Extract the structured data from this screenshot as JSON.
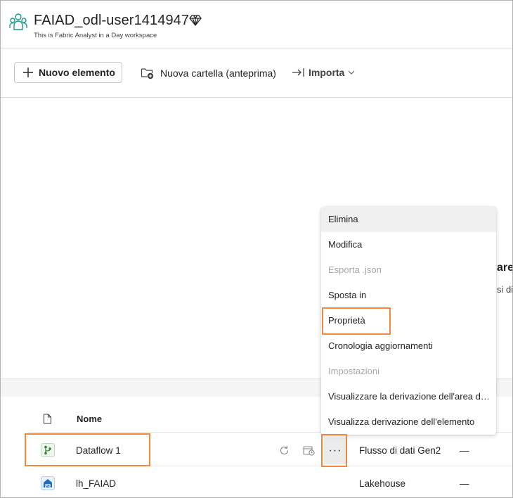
{
  "workspace": {
    "title": "FAIAD_odl-user1414947",
    "subtitle": "This is Fabric Analyst in a Day workspace"
  },
  "toolbar": {
    "new_item_label": "Nuovo elemento",
    "new_folder_label": "Nuova cartella (anteprima)",
    "import_label": "Importa"
  },
  "background_text": {
    "heading_fragment": "are",
    "sub_fragment": "si di"
  },
  "table": {
    "column_name": "Nome",
    "rows": [
      {
        "name": "Dataflow 1",
        "type": "Flusso di dati Gen2",
        "extra": "—",
        "icon": "dataflow-icon",
        "more": "···"
      },
      {
        "name": "lh_FAIAD",
        "type": "Lakehouse",
        "extra": "—",
        "icon": "lakehouse-icon"
      }
    ]
  },
  "context_menu": {
    "items": [
      {
        "label": "Elimina",
        "state": "hover"
      },
      {
        "label": "Modifica",
        "state": "normal"
      },
      {
        "label": "Esporta .json",
        "state": "disabled"
      },
      {
        "label": "Sposta in",
        "state": "normal"
      },
      {
        "label": "Proprietà",
        "state": "highlighted"
      },
      {
        "label": "Cronologia aggiornamenti",
        "state": "normal"
      },
      {
        "label": "Impostazioni",
        "state": "disabled"
      },
      {
        "label": "Visualizzare la derivazione dell'area di lavoro",
        "state": "normal"
      },
      {
        "label": "Visualizza derivazione dell'elemento",
        "state": "normal"
      }
    ]
  },
  "colors": {
    "highlight": "#f0883e",
    "workspace_icon": "#1a9a8a",
    "dataflow_icon": "#2f7d32",
    "lakehouse_icon": "#1f6fbf"
  }
}
